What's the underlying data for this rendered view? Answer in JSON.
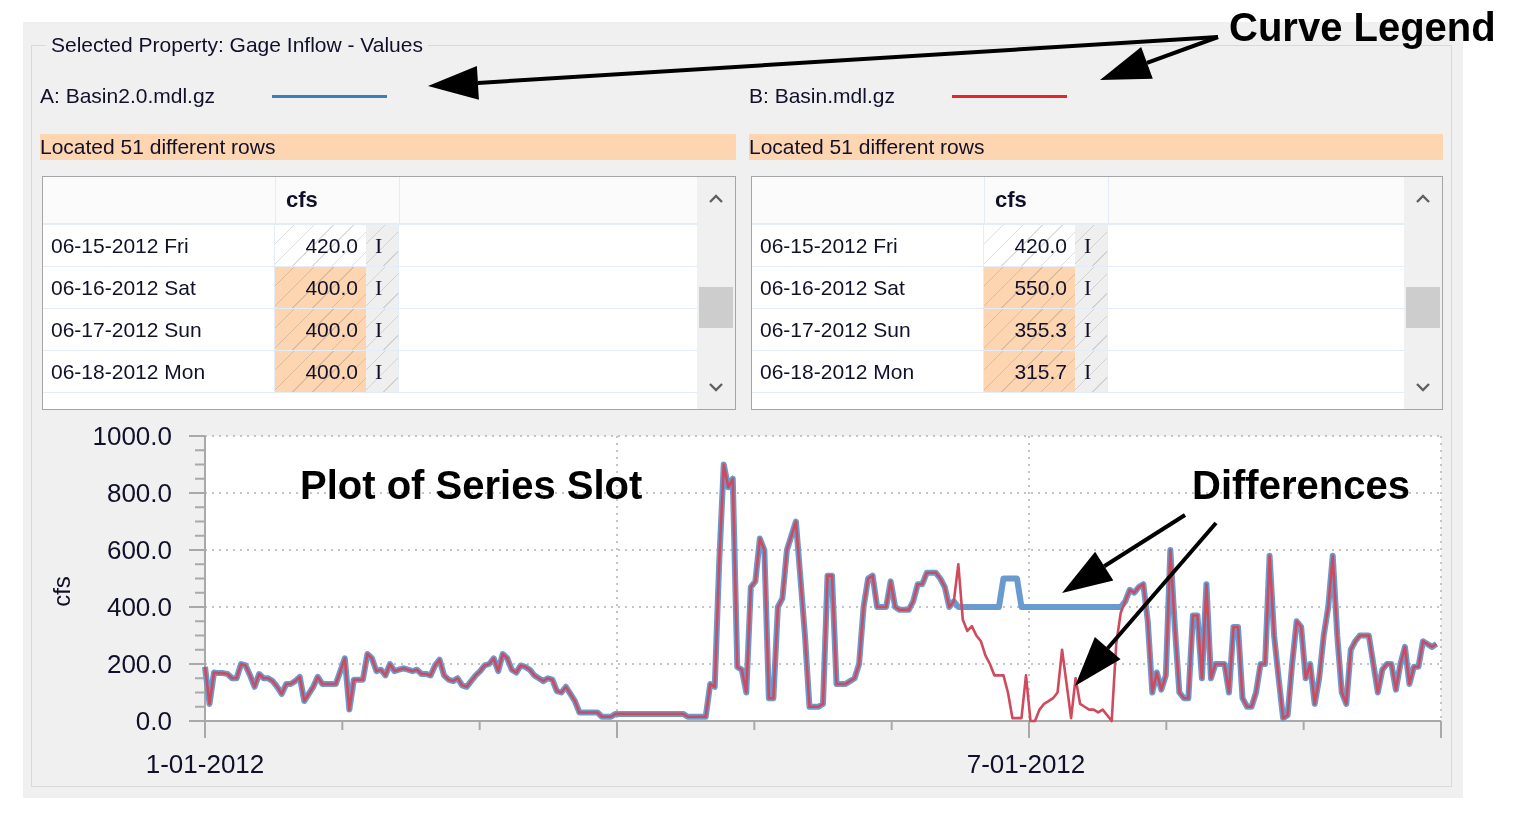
{
  "group": {
    "title": "Selected Property: Gage Inflow - Values"
  },
  "models": [
    {
      "label": "A: Basin2.0.mdl.gz",
      "color": "#3b7dbf",
      "status": "Located 51 different rows",
      "table": {
        "heading": "cfs",
        "rows": [
          {
            "date": "06-15-2012 Fri",
            "value": "420.0",
            "flag": "I",
            "different": false
          },
          {
            "date": "06-16-2012 Sat",
            "value": "400.0",
            "flag": "I",
            "different": true
          },
          {
            "date": "06-17-2012 Sun",
            "value": "400.0",
            "flag": "I",
            "different": true
          },
          {
            "date": "06-18-2012 Mon",
            "value": "400.0",
            "flag": "I",
            "different": true
          }
        ]
      }
    },
    {
      "label": "B: Basin.mdl.gz",
      "color": "#e8262a",
      "status": "Located 51 different rows",
      "table": {
        "heading": "cfs",
        "rows": [
          {
            "date": "06-15-2012 Fri",
            "value": "420.0",
            "flag": "I",
            "different": false
          },
          {
            "date": "06-16-2012 Sat",
            "value": "550.0",
            "flag": "I",
            "different": true
          },
          {
            "date": "06-17-2012 Sun",
            "value": "355.3",
            "flag": "I",
            "different": true
          },
          {
            "date": "06-18-2012 Mon",
            "value": "315.7",
            "flag": "I",
            "different": true
          }
        ]
      }
    }
  ],
  "plot": {
    "chart_data": {
      "type": "line",
      "ylabel": "cfs",
      "grid": true,
      "categories": [
        "1-01-2012",
        null,
        null,
        null,
        null,
        null,
        null,
        null,
        null,
        null,
        null,
        null,
        null,
        null,
        null,
        null,
        null,
        null,
        null,
        null,
        null,
        null,
        null,
        null,
        null,
        null,
        null,
        null,
        null,
        null,
        null,
        null,
        null,
        null,
        null,
        null,
        null,
        null,
        null,
        null,
        null,
        null,
        null,
        null,
        null,
        null,
        null,
        null,
        null,
        null,
        null,
        null,
        null,
        null,
        null,
        null,
        null,
        null,
        null,
        null,
        null,
        null,
        null,
        null,
        null,
        null,
        null,
        null,
        null,
        null,
        null,
        null,
        null,
        null,
        null,
        null,
        null,
        null,
        null,
        null,
        null,
        null,
        null,
        null,
        null,
        null,
        null,
        null,
        null,
        null,
        null,
        null,
        null,
        null,
        null,
        null,
        null,
        null,
        null,
        null,
        null,
        null,
        null,
        null,
        null,
        null,
        null,
        null,
        null,
        null,
        null,
        null,
        null,
        null,
        null,
        null,
        null,
        null,
        null,
        null,
        null,
        null,
        null,
        null,
        null,
        null,
        null,
        null,
        null,
        null,
        null,
        null,
        null,
        null,
        null,
        null,
        null,
        null,
        null,
        null,
        null,
        null,
        null,
        null,
        null,
        null,
        null,
        null,
        null,
        null,
        null,
        null,
        null,
        null,
        null,
        null,
        null,
        null,
        null,
        null,
        null,
        null,
        null,
        null,
        null,
        null,
        null,
        null,
        null,
        null,
        null,
        null,
        null,
        null,
        null,
        null,
        null,
        null,
        null,
        null,
        null,
        null,
        "7-01-2012",
        null,
        null,
        null,
        null,
        null,
        null,
        null,
        null,
        null,
        null,
        null,
        null,
        null,
        null,
        null,
        null,
        null,
        null,
        null,
        null,
        null,
        null,
        null,
        null,
        null,
        null,
        null,
        null,
        null,
        null,
        null,
        null,
        null,
        null,
        null,
        null,
        null,
        null,
        null,
        null,
        null,
        null,
        null,
        null,
        null,
        null,
        null,
        null,
        null,
        null,
        null,
        null,
        null,
        null,
        null,
        null,
        null,
        null,
        null,
        null,
        null,
        null,
        null,
        null,
        null,
        null,
        null,
        null,
        null,
        null,
        null,
        null,
        null,
        null,
        null,
        null,
        null,
        null,
        null,
        null,
        null,
        null,
        null,
        null,
        null,
        null,
        null,
        null,
        null,
        null,
        null
      ],
      "series": [
        {
          "color": "#6a9bcf",
          "values": [
            190,
            60,
            170,
            168,
            168,
            165,
            150,
            150,
            200,
            195,
            160,
            120,
            165,
            150,
            150,
            140,
            120,
            95,
            130,
            130,
            140,
            155,
            70,
            95,
            120,
            155,
            130,
            130,
            130,
            130,
            175,
            220,
            40,
            145,
            145,
            145,
            235,
            220,
            175,
            180,
            160,
            200,
            175,
            180,
            185,
            180,
            175,
            180,
            165,
            165,
            160,
            195,
            215,
            160,
            145,
            140,
            150,
            125,
            120,
            140,
            160,
            175,
            195,
            200,
            220,
            175,
            235,
            220,
            180,
            170,
            195,
            190,
            180,
            160,
            150,
            140,
            150,
            145,
            105,
            100,
            120,
            95,
            70,
            30,
            30,
            30,
            30,
            30,
            15,
            15,
            15,
            25,
            25,
            25,
            25,
            25,
            25,
            25,
            25,
            25,
            25,
            25,
            25,
            25,
            25,
            25,
            25,
            15,
            15,
            15,
            15,
            15,
            130,
            120,
            560,
            900,
            820,
            850,
            190,
            180,
            100,
            470,
            490,
            640,
            600,
            80,
            80,
            400,
            430,
            600,
            650,
            700,
            500,
            300,
            50,
            50,
            50,
            60,
            510,
            510,
            130,
            130,
            130,
            140,
            150,
            200,
            400,
            500,
            510,
            400,
            400,
            400,
            490,
            400,
            390,
            390,
            390,
            420,
            480,
            480,
            520,
            520,
            520,
            500,
            470,
            400,
            420,
            400,
            400,
            400,
            400,
            400,
            400,
            400,
            400,
            400,
            400,
            500,
            500,
            500,
            500,
            400,
            400,
            400,
            400,
            400,
            400,
            400,
            400,
            400,
            400,
            400,
            400,
            400,
            400,
            400,
            400,
            400,
            400,
            400,
            400,
            400,
            400,
            400,
            420,
            460,
            450,
            470,
            480,
            350,
            100,
            170,
            110,
            160,
            600,
            330,
            100,
            80,
            80,
            370,
            370,
            150,
            480,
            150,
            200,
            200,
            200,
            100,
            330,
            330,
            80,
            50,
            50,
            100,
            200,
            200,
            580,
            300,
            150,
            10,
            20,
            200,
            350,
            330,
            150,
            200,
            60,
            150,
            300,
            400,
            580,
            300,
            100,
            60,
            250,
            280,
            300,
            300,
            300,
            200,
            100,
            180,
            200,
            200,
            110,
            200,
            260,
            130,
            190,
            190,
            280,
            270,
            260,
            270
          ]
        },
        {
          "color": "#cf4a5c",
          "values": [
            190,
            60,
            170,
            168,
            168,
            165,
            150,
            150,
            200,
            195,
            160,
            120,
            165,
            150,
            150,
            140,
            120,
            95,
            130,
            130,
            140,
            155,
            70,
            95,
            120,
            155,
            130,
            130,
            130,
            130,
            175,
            220,
            40,
            145,
            145,
            145,
            235,
            220,
            175,
            180,
            160,
            200,
            175,
            180,
            185,
            180,
            175,
            180,
            165,
            165,
            160,
            195,
            215,
            160,
            145,
            140,
            150,
            125,
            120,
            140,
            160,
            175,
            195,
            200,
            220,
            175,
            235,
            220,
            180,
            170,
            195,
            190,
            180,
            160,
            150,
            140,
            150,
            145,
            105,
            100,
            120,
            95,
            70,
            30,
            30,
            30,
            30,
            30,
            15,
            15,
            15,
            25,
            25,
            25,
            25,
            25,
            25,
            25,
            25,
            25,
            25,
            25,
            25,
            25,
            25,
            25,
            25,
            15,
            15,
            15,
            15,
            15,
            130,
            120,
            560,
            900,
            820,
            850,
            190,
            180,
            100,
            470,
            490,
            640,
            600,
            80,
            80,
            400,
            430,
            600,
            650,
            700,
            500,
            300,
            50,
            50,
            50,
            60,
            510,
            510,
            130,
            130,
            130,
            140,
            150,
            200,
            400,
            500,
            510,
            400,
            400,
            400,
            490,
            400,
            390,
            390,
            390,
            420,
            480,
            480,
            520,
            520,
            520,
            500,
            470,
            400,
            420,
            550,
            355,
            316,
            333,
            300,
            280,
            230,
            200,
            160,
            160,
            160,
            100,
            10,
            10,
            10,
            160,
            0,
            0,
            40,
            60,
            70,
            80,
            100,
            250,
            130,
            10,
            150,
            60,
            50,
            40,
            40,
            30,
            40,
            20,
            0,
            270,
            380,
            420,
            460,
            450,
            470,
            480,
            350,
            100,
            170,
            110,
            160,
            600,
            330,
            100,
            80,
            80,
            370,
            370,
            150,
            480,
            150,
            200,
            200,
            200,
            100,
            330,
            330,
            80,
            50,
            50,
            100,
            200,
            200,
            580,
            300,
            150,
            10,
            20,
            200,
            350,
            330,
            150,
            200,
            60,
            150,
            300,
            400,
            580,
            300,
            100,
            60,
            250,
            280,
            300,
            300,
            300,
            200,
            100,
            180,
            200,
            200,
            110,
            200,
            260,
            130,
            190,
            190,
            280,
            270,
            260,
            270
          ]
        }
      ],
      "ylim": [
        0,
        1000
      ],
      "yticks": [
        {
          "value": 0,
          "label": "0.0"
        },
        {
          "value": 200,
          "label": "200.0"
        },
        {
          "value": 400,
          "label": "400.0"
        },
        {
          "value": 600,
          "label": "600.0"
        },
        {
          "value": 800,
          "label": "800.0"
        },
        {
          "value": 1000,
          "label": "1000.0"
        }
      ]
    }
  },
  "callouts": [
    {
      "text": "Curve Legend"
    },
    {
      "text": "Plot of Series Slot"
    },
    {
      "text": "Differences"
    }
  ]
}
